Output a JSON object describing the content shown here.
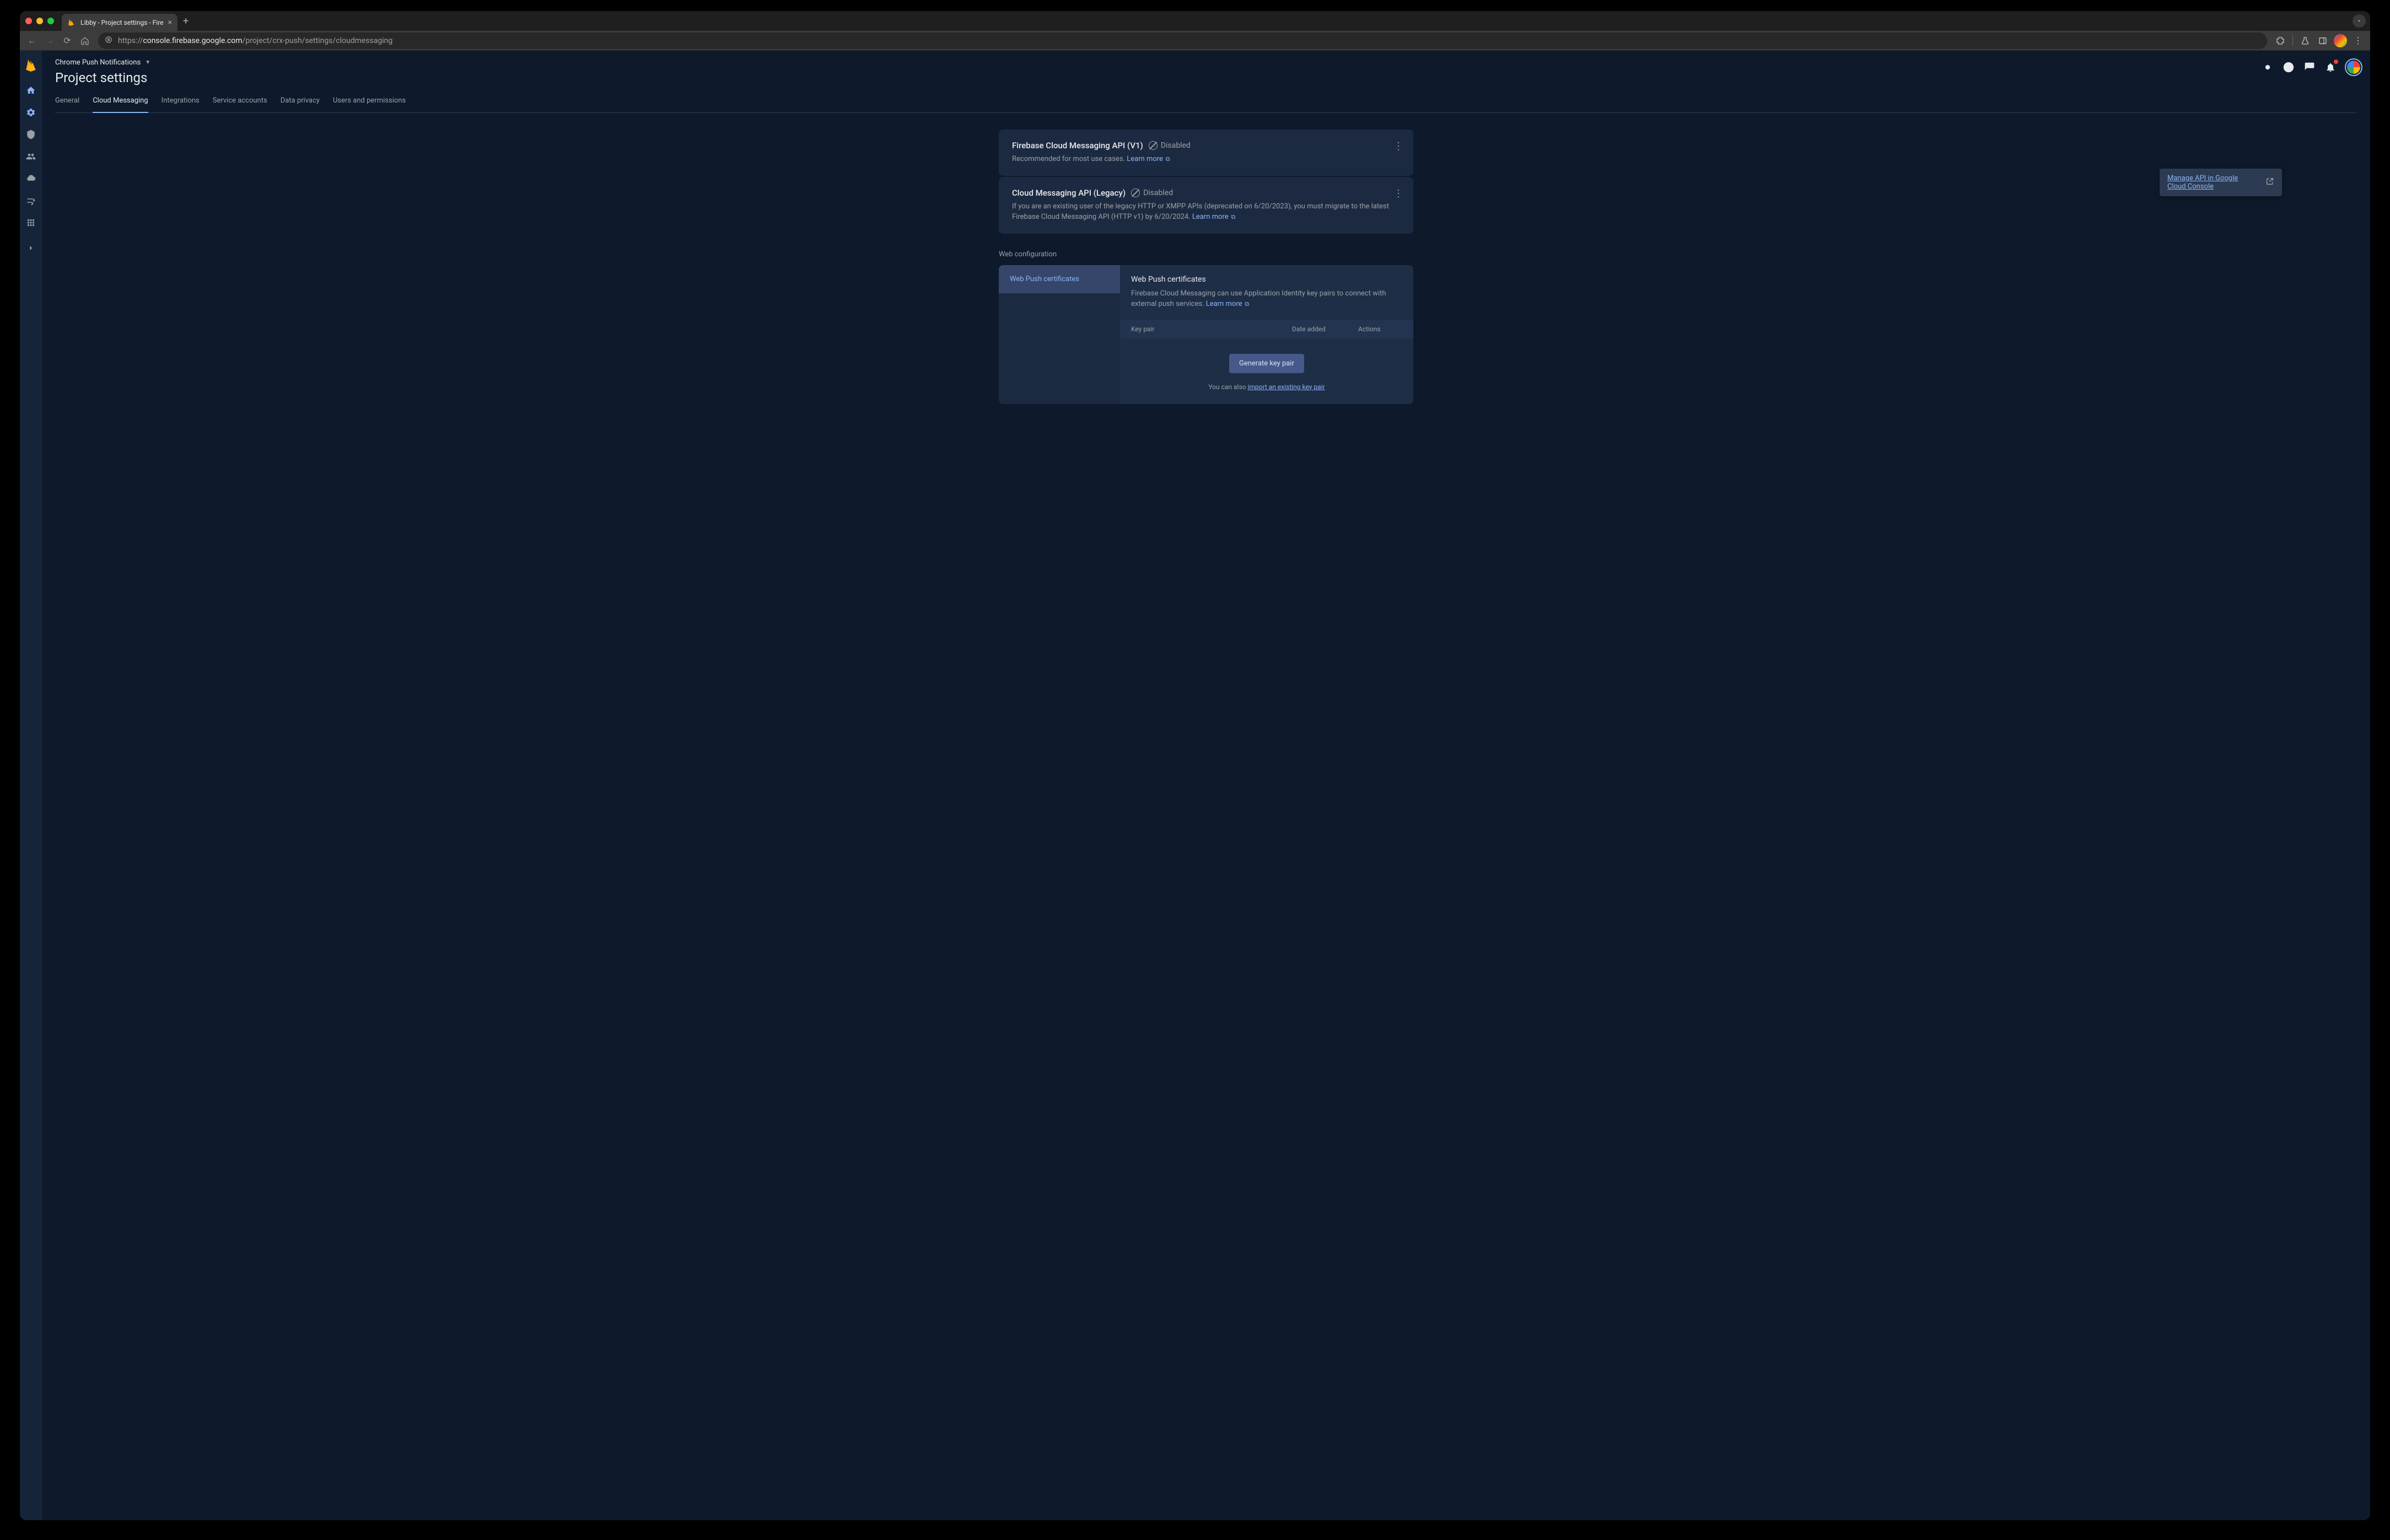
{
  "browser": {
    "tab_title": "Libby - Project settings - Fire",
    "url_prefix": "https://",
    "url_host": "console.firebase.google.com",
    "url_path": "/project/crx-push/settings/cloudmessaging"
  },
  "header": {
    "project_name": "Chrome Push Notifications",
    "page_title": "Project settings",
    "tabs": [
      "General",
      "Cloud Messaging",
      "Integrations",
      "Service accounts",
      "Data privacy",
      "Users and permissions"
    ],
    "active_tab_index": 1
  },
  "api_v1": {
    "title": "Firebase Cloud Messaging API (V1)",
    "status": "Disabled",
    "desc": "Recommended for most use cases.",
    "learn_more": "Learn more"
  },
  "api_legacy": {
    "title": "Cloud Messaging API (Legacy)",
    "status": "Disabled",
    "desc": "If you are an existing user of the legacy HTTP or XMPP APIs (deprecated on 6/20/2023), you must migrate to the latest Firebase Cloud Messaging API (HTTP v1) by 6/20/2024.",
    "learn_more": "Learn more"
  },
  "tooltip": {
    "text": "Manage API in Google Cloud Console"
  },
  "web_config": {
    "section_label": "Web configuration",
    "sidebar_tab": "Web Push certificates",
    "title": "Web Push certificates",
    "desc": "Firebase Cloud Messaging can use Application Identity key pairs to connect with external push services.",
    "learn_more": "Learn more",
    "th_key": "Key pair",
    "th_date": "Date added",
    "th_actions": "Actions",
    "gen_btn": "Generate key pair",
    "import_prefix": "You can also ",
    "import_link": "import an existing key pair"
  }
}
